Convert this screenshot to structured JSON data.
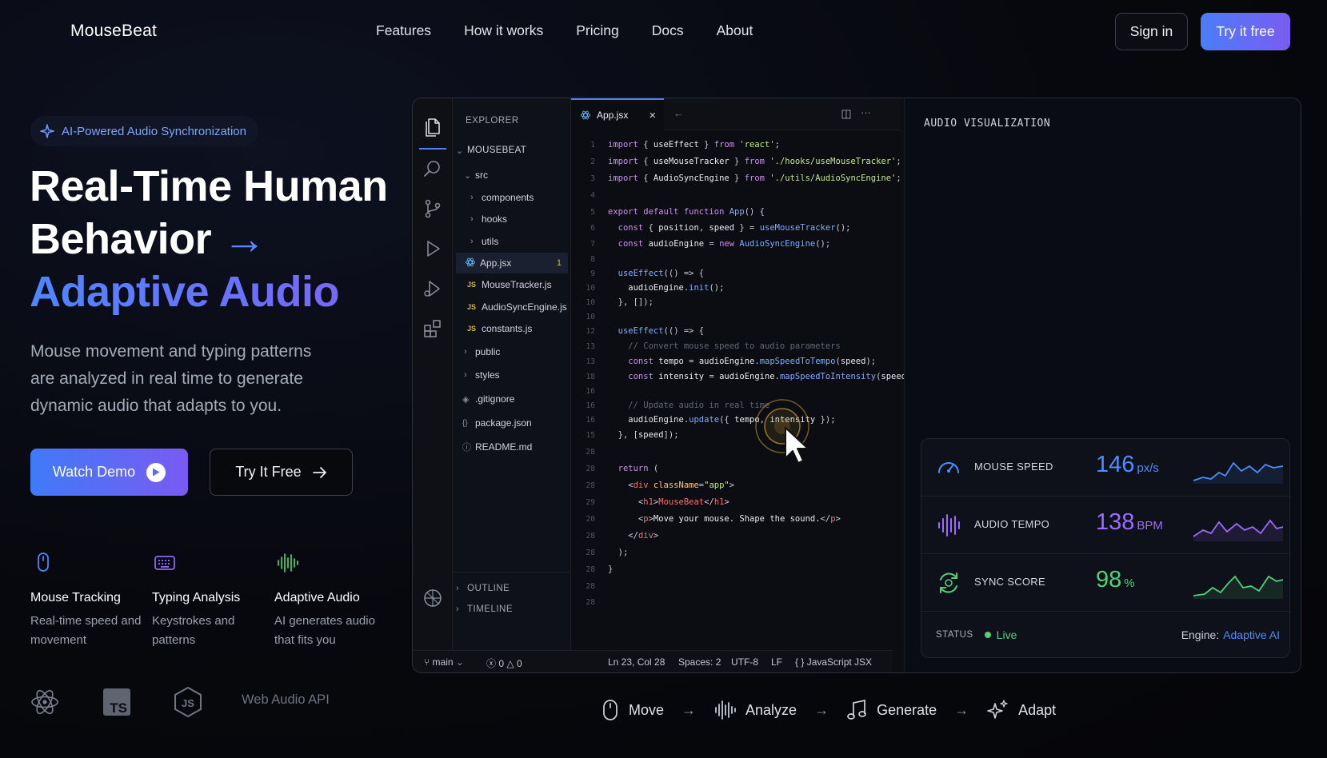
{
  "nav": {
    "brand": "MouseBeat",
    "links": [
      "Features",
      "How it works",
      "Pricing",
      "Docs",
      "About"
    ],
    "sign_in": "Sign in",
    "try_free": "Try it free"
  },
  "hero": {
    "badge": "AI-Powered Audio Synchronization",
    "title_line1": "Real-Time Human",
    "title_line2": "Behavior",
    "title_arrow": "→",
    "title_line3": "Adaptive Audio",
    "description": "Mouse movement and typing patterns are analyzed in real time to generate dynamic audio that adapts to you.",
    "watch_demo": "Watch Demo",
    "try_it_free": "Try It Free",
    "features": [
      {
        "title": "Mouse Tracking",
        "desc": "Real-time speed and movement",
        "icon": "mouse-icon"
      },
      {
        "title": "Typing Analysis",
        "desc": "Keystrokes and patterns",
        "icon": "keyboard-icon"
      },
      {
        "title": "Adaptive Audio",
        "desc": "AI generates audio that fits you",
        "icon": "waveform-icon"
      }
    ],
    "tech": [
      "react-icon",
      "typescript-icon",
      "nodejs-icon"
    ],
    "tech_ts": "TS",
    "tech_js": "JS",
    "web_audio": "Web Audio API"
  },
  "editor": {
    "explorer_title": "EXPLORER",
    "project": "MOUSEBEAT",
    "tree": {
      "src": "src",
      "components": "components",
      "hooks": "hooks",
      "utils": "utils",
      "app": "App.jsx",
      "app_badge": "1",
      "mousetracker": "MouseTracker.js",
      "audiosync": "AudioSyncEngine.js",
      "constants": "constants.js",
      "public": "public",
      "styles": "styles",
      "gitignore": ".gitignore",
      "package": "package.json",
      "readme": "README.md",
      "outline": "OUTLINE",
      "timeline": "TIMELINE"
    },
    "js_badge": "JS",
    "tab": "App.jsx",
    "tab_close": "×",
    "line_numbers": [
      "1",
      "2",
      "3",
      "4",
      "5",
      "6",
      "7",
      "8",
      "9",
      "10",
      "10",
      "10",
      "12",
      "13",
      "13",
      "18",
      "16",
      "16",
      "16",
      "15",
      "28",
      "28",
      "28",
      "29",
      "20",
      "28",
      "28",
      "28",
      "28"
    ],
    "status": {
      "branch": "main",
      "problems": "0",
      "warnings": "0",
      "position": "Ln 23, Col 28",
      "spaces": "Spaces: 2",
      "encoding": "UTF-8",
      "eol": "LF",
      "language": "JavaScript JSX"
    }
  },
  "audio_panel": {
    "title": "AUDIO VISUALIZATION",
    "metrics": [
      {
        "label": "MOUSE SPEED",
        "value": "146",
        "unit": "px/s",
        "color": "#4c8dff",
        "icon": "speedometer-icon"
      },
      {
        "label": "AUDIO TEMPO",
        "value": "138",
        "unit": "BPM",
        "color": "#9d6bff",
        "icon": "waveform-icon"
      },
      {
        "label": "SYNC SCORE",
        "value": "98",
        "unit": "%",
        "color": "#4fd17a",
        "icon": "sync-icon"
      }
    ],
    "status_label": "STATUS",
    "status_value": "Live",
    "engine_label": "Engine:",
    "engine_value": "Adaptive AI"
  },
  "pipeline": {
    "steps": [
      "Move",
      "Analyze",
      "Generate",
      "Adapt"
    ],
    "arrow": "→"
  },
  "colors": {
    "accent_blue": "#4b7df7",
    "accent_purple": "#7a5cf2",
    "live_green": "#4fd17a"
  }
}
